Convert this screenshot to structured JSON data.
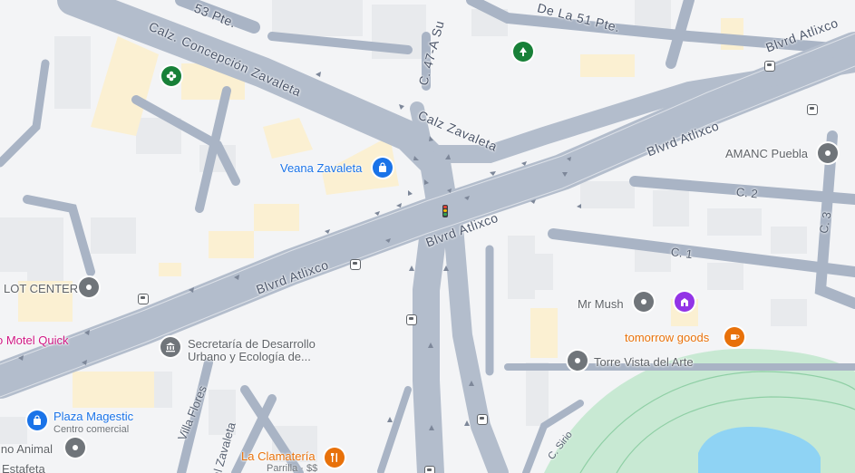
{
  "map": {
    "roads": {
      "calle_53": "53 Pte.",
      "calle_51": "De La 51 Pte.",
      "calzada_concepcion": "Calz. Concepción Zavaleta",
      "calz_zavaleta": "Calz Zavaleta",
      "calle_47a": "C. 47-A Su",
      "blvd_atlixco_ne": "Blvrd Atlixco",
      "blvd_atlixco_e": "Blvrd Atlixco",
      "blvd_atlixco_c": "Blvrd Atlixco",
      "blvd_atlixco_w": "Blvrd Atlixco",
      "calle_2": "C. 2",
      "calle_1": "C. 1",
      "calle_3": "C. 3",
      "villa_flores": "Villa Flores",
      "zavaleta_s": "al Zavaleta",
      "calle_sirio": "C. Sirio"
    },
    "pois": {
      "veana": {
        "name": "Veana Zavaleta",
        "icon": "shopping-bag-icon",
        "color": "#1a73e8"
      },
      "amanc": {
        "name": "AMANC Puebla",
        "icon": "place-pin-icon",
        "color": "#70757a"
      },
      "lot_center": {
        "name": "LOT CENTER",
        "icon": "place-pin-icon",
        "color": "#70757a"
      },
      "motel": {
        "name": "o Motel Quick",
        "color": "#d01884"
      },
      "secretaria": {
        "line1": "Secretaría de Desarrollo",
        "line2": "Urbano y Ecología de...",
        "icon": "government-building-icon",
        "color": "#70757a"
      },
      "mr_mush": {
        "name": "Mr Mush",
        "icon": "place-pin-icon",
        "color": "#70757a"
      },
      "tomorrow": {
        "name": "tomorrow goods",
        "icon": "coffee-cup-icon",
        "color": "#e8710a"
      },
      "torre": {
        "name": "Torre Vista del Arte",
        "icon": "place-pin-icon",
        "color": "#70757a"
      },
      "plaza": {
        "name": "Plaza Magestic",
        "sub": "Centro comercial",
        "icon": "shopping-bag-icon",
        "color": "#1a73e8"
      },
      "animal": {
        "name": "ino Animal",
        "icon": "place-pin-icon",
        "color": "#70757a"
      },
      "estafeta": {
        "name": "Estafeta"
      },
      "clamateria": {
        "name": "La Clamatería",
        "sub": "Parrilla · $$",
        "icon": "fork-knife-icon",
        "color": "#e8710a"
      }
    },
    "icons": {
      "park": "tree-icon",
      "garden": "flower-icon",
      "museum": "landmark-icon",
      "traffic_light": "traffic-light-icon",
      "bus_stop": "bus-stop-icon"
    }
  }
}
